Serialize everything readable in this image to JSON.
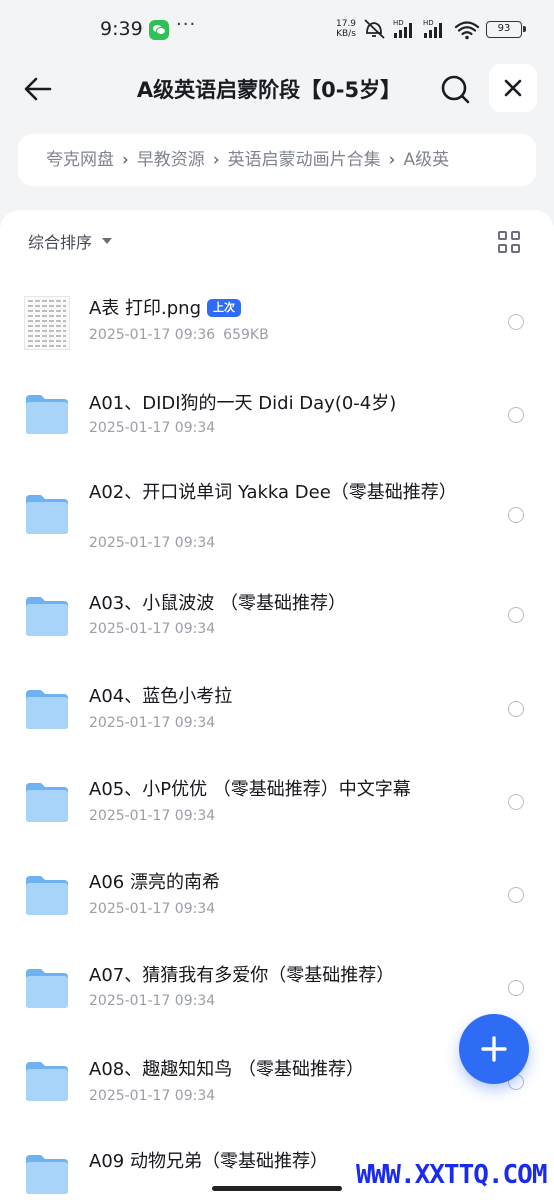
{
  "status_bar": {
    "time": "9:39",
    "more": "···",
    "net_speed_value": "17.9",
    "net_speed_unit": "KB/s",
    "hd1": "HD",
    "hd2": "HD",
    "battery": "93"
  },
  "header": {
    "title": "A级英语启蒙阶段【0-5岁】"
  },
  "breadcrumb": [
    "夸克网盘",
    "早教资源",
    "英语启蒙动画片合集",
    "A级英"
  ],
  "breadcrumb_separator": "›",
  "toolbar": {
    "sort_label": "综合排序"
  },
  "files": [
    {
      "name": "A表 打印.png",
      "badge": "上次",
      "date": "2025-01-17 09:36",
      "size": "659KB",
      "type": "image"
    },
    {
      "name": "A01、DIDI狗的一天 Didi Day(0-4岁)",
      "date": "2025-01-17 09:34",
      "type": "folder"
    },
    {
      "name": "A02、开口说单词 Yakka Dee（零基础推荐）",
      "date": "2025-01-17 09:34",
      "type": "folder"
    },
    {
      "name": "A03、小鼠波波 （零基础推荐）",
      "date": "2025-01-17 09:34",
      "type": "folder"
    },
    {
      "name": "A04、蓝色小考拉",
      "date": "2025-01-17 09:34",
      "type": "folder"
    },
    {
      "name": "A05、小P优优 （零基础推荐）中文字幕",
      "date": "2025-01-17 09:34",
      "type": "folder"
    },
    {
      "name": "A06 漂亮的南希",
      "date": "2025-01-17 09:34",
      "type": "folder"
    },
    {
      "name": "A07、猜猜我有多爱你（零基础推荐）",
      "date": "2025-01-17 09:34",
      "type": "folder"
    },
    {
      "name": "A08、趣趣知知鸟 （零基础推荐）",
      "date": "2025-01-17 09:34",
      "type": "folder"
    },
    {
      "name": "A09 动物兄弟（零基础推荐）",
      "date": "",
      "type": "folder"
    }
  ],
  "watermark": "WWW.XXTTQ.COM",
  "colors": {
    "accent": "#2f6cf6",
    "folder": "#7fbcf5",
    "background": "#f3f4f6"
  }
}
